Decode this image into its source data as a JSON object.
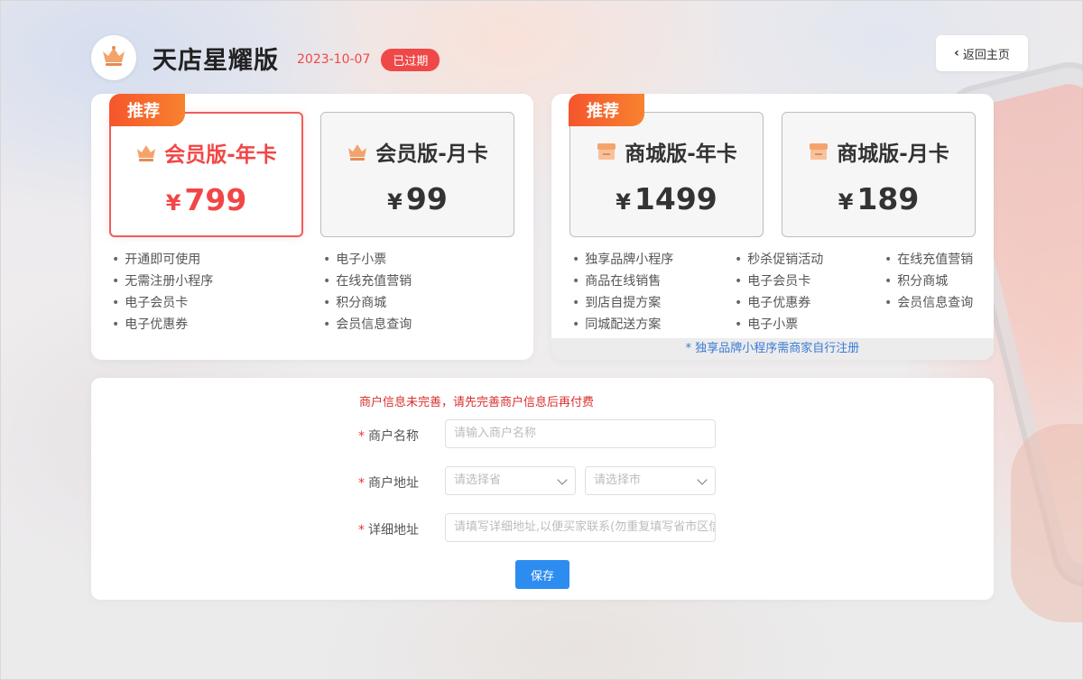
{
  "header": {
    "title": "天店星耀版",
    "expire_date": "2023-10-07",
    "status": "已过期",
    "back_label": "返回主页"
  },
  "member_panel": {
    "tag": "推荐",
    "plans": [
      {
        "name": "会员版-年卡",
        "currency": "¥",
        "price": "799",
        "selected": true
      },
      {
        "name": "会员版-月卡",
        "currency": "¥",
        "price": "99",
        "selected": false
      }
    ],
    "features_col1": [
      "开通即可使用",
      "无需注册小程序",
      "电子会员卡",
      "电子优惠券"
    ],
    "features_col2": [
      "电子小票",
      "在线充值营销",
      "积分商城",
      "会员信息查询"
    ]
  },
  "mall_panel": {
    "tag": "推荐",
    "plans": [
      {
        "name": "商城版-年卡",
        "currency": "¥",
        "price": "1499",
        "selected": false
      },
      {
        "name": "商城版-月卡",
        "currency": "¥",
        "price": "189",
        "selected": false
      }
    ],
    "features_col1": [
      "独享品牌小程序",
      "商品在线销售",
      "到店自提方案",
      "同城配送方案"
    ],
    "features_col2": [
      "秒杀促销活动",
      "电子会员卡",
      "电子优惠券",
      "电子小票"
    ],
    "features_col3": [
      "在线充值营销",
      "积分商城",
      "会员信息查询"
    ],
    "note": "* 独享品牌小程序需商家自行注册"
  },
  "form": {
    "warning": "商户信息未完善，请先完善商户信息后再付费",
    "required_mark": "*",
    "name_label": "商户名称",
    "name_placeholder": "请输入商户名称",
    "address_label": "商户地址",
    "province_placeholder": "请选择省",
    "city_placeholder": "请选择市",
    "detail_label": "详细地址",
    "detail_placeholder": "请填写详细地址,以便买家联系(勿重复填写省市区信息)",
    "save_label": "保存"
  },
  "colors": {
    "accent_red": "#f24646",
    "tag_orange": "#f5552c",
    "save_blue": "#2d8cf0",
    "note_blue": "#3a7bd5"
  },
  "icons": {
    "avatar": "crown-icon",
    "member_plan": "crown-icon",
    "mall_plan": "shop-icon",
    "back": "chevron-left-icon",
    "select": "chevron-down-icon"
  }
}
